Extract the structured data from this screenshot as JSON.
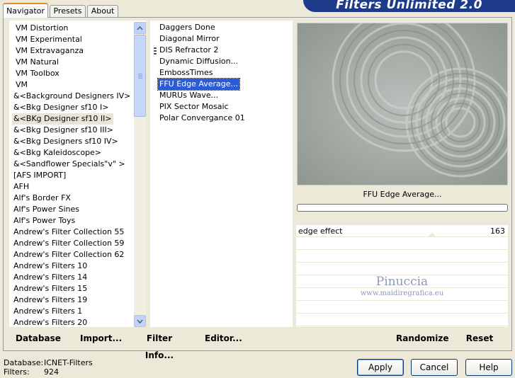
{
  "tabs": [
    "Navigator",
    "Presets",
    "About"
  ],
  "banner_title": "Filters Unlimited 2.0",
  "categories": [
    "VM Distortion",
    "VM Experimental",
    "VM Extravaganza",
    "VM Natural",
    "VM Toolbox",
    "VM",
    "&<Background Designers IV>",
    "&<Bkg Designer sf10 I>",
    "&<BKg Designer sf10 II>",
    "&<Bkg Designer sf10 III>",
    "&<Bkg Designers sf10 IV>",
    "&<Bkg Kaleidoscope>",
    "&<Sandflower Specials\"v\" >",
    "[AFS IMPORT]",
    "AFH",
    "Alf's Border FX",
    "Alf's Power Sines",
    "Alf's Power Toys",
    "Andrew's Filter Collection 55",
    "Andrew's Filter Collection 59",
    "Andrew's Filter Collection 62",
    "Andrew's Filters 10",
    "Andrew's Filters 14",
    "Andrew's Filters 15",
    "Andrew's Filters 19",
    "Andrew's Filters 1",
    "Andrew's Filters 20"
  ],
  "selected_category": 8,
  "filters": [
    "Daggers Done",
    "Diagonal Mirror",
    "DIS Refractor 2",
    "Dynamic Diffusion...",
    "EmbossTimes",
    "FFU Edge Average...",
    "MURUs Wave...",
    "PIX Sector Mosaic",
    "Polar Convergance 01"
  ],
  "selected_filter": 5,
  "preview_label": "FFU Edge Average...",
  "param": {
    "name": "edge effect",
    "value": "163"
  },
  "watermark": {
    "name": "Pinuccia",
    "url": "www.maidiregrafica.eu"
  },
  "toolbar": {
    "database": "Database",
    "import": "Import...",
    "filter_info": "Filter Info...",
    "editor": "Editor...",
    "randomize": "Randomize",
    "reset": "Reset"
  },
  "status": {
    "database_label": "Database:",
    "database_value": "ICNET-Filters",
    "filters_label": "Filters:",
    "filters_value": "924"
  },
  "buttons": {
    "apply": "Apply",
    "cancel": "Cancel",
    "help": "Help"
  },
  "colors": {
    "banner": "#1d3b8a",
    "selection": "#2b5bd7",
    "preview": "#a8aea9"
  }
}
